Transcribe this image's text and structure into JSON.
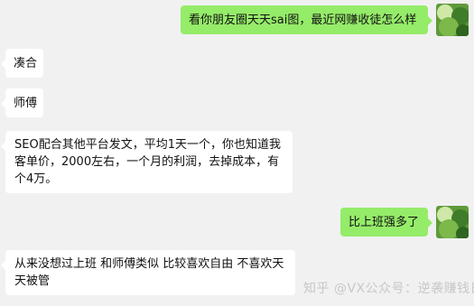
{
  "messages": {
    "m1": {
      "side": "right",
      "text": "看你朋友圈天天sai图，最近网赚收徒怎么样"
    },
    "m2": {
      "side": "left",
      "text": "凑合"
    },
    "m3": {
      "side": "left",
      "text": "师傅"
    },
    "m4": {
      "side": "left",
      "lines": [
        "SEO配合其他平台发文，平均1天一个，你也知道我",
        "客单价，2000左右，一个月的利润，去掉成本，有",
        "个4万。"
      ]
    },
    "m5": {
      "side": "right",
      "text": "比上班强多了"
    },
    "m6": {
      "side": "left",
      "lines": [
        "从来没想过上班 和师傅类似 比较喜欢自由 不喜欢天",
        "天被管"
      ]
    }
  },
  "watermark": {
    "text": "知乎 @VX公众号：逆袭赚钱日记"
  },
  "colors": {
    "background": "#f1f1f1",
    "sent_bubble": "#95ec69",
    "received_bubble": "#ffffff"
  },
  "avatar": {
    "icon": "green-nature-avatar-icon"
  }
}
